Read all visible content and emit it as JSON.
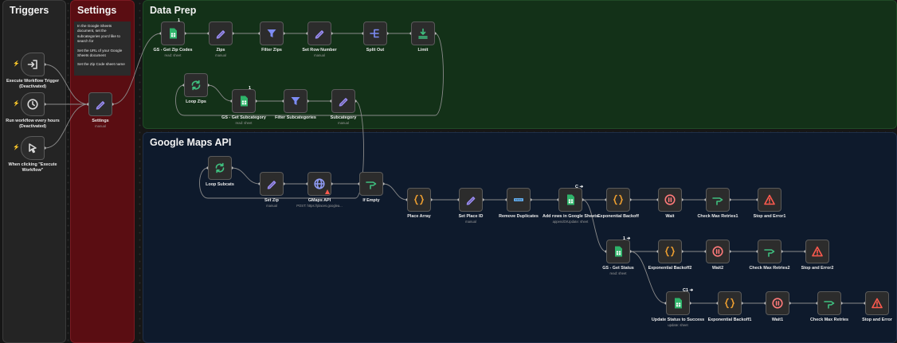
{
  "canvas": {
    "sticky_notes": [
      {
        "id": "triggers",
        "title": "Triggers",
        "lines": [],
        "color": "#242424",
        "border": "#3a3a3a"
      },
      {
        "id": "settings",
        "title": "Settings",
        "lines": [
          "In the Google Sheets document, set the subcategories you'd like to search for",
          "Set the URL of your Google Sheets document",
          "Set the Zip Code sheet name"
        ],
        "color": "#5a0d12",
        "border": "#7a1a22"
      },
      {
        "id": "dataprep",
        "title": "Data Prep",
        "lines": [],
        "color": "#133118",
        "border": "#1f4a26"
      },
      {
        "id": "gmaps",
        "title": "Google Maps API",
        "lines": [],
        "color": "#0e1a2c",
        "border": "#1f2e47"
      }
    ],
    "nodes": [
      {
        "id": "execute-workflow-trigger",
        "label": "Execute Workflow Trigger (Deactivated)",
        "subtitle": "",
        "icon": "arrow-in-icon",
        "icon_color": "#d8d8d8",
        "trigger": true
      },
      {
        "id": "schedule-trigger",
        "label": "Run workflow every hours (Deactivated)",
        "subtitle": "",
        "icon": "clock-icon",
        "icon_color": "#d8d8d8",
        "trigger": true
      },
      {
        "id": "manual-trigger",
        "label": "When clicking \"Execute Workflow\"",
        "subtitle": "",
        "icon": "cursor-icon",
        "icon_color": "#d8d8d8",
        "trigger": true
      },
      {
        "id": "settings",
        "label": "Settings",
        "subtitle": "manual",
        "icon": "pencil-icon",
        "icon_color": "#9b8cf5"
      },
      {
        "id": "gs-get-zip-codes",
        "label": "GS - Get Zip Codes",
        "subtitle": "read: sheet",
        "icon": "sheets-icon",
        "icon_color": "#2eb46a",
        "badge": "1"
      },
      {
        "id": "zips",
        "label": "Zips",
        "subtitle": "manual",
        "icon": "pencil-icon",
        "icon_color": "#9b8cf5"
      },
      {
        "id": "filter-zips",
        "label": "Filter Zips",
        "subtitle": "",
        "icon": "filter-icon",
        "icon_color": "#7d8cf5"
      },
      {
        "id": "set-row-number",
        "label": "Set Row Number",
        "subtitle": "manual",
        "icon": "pencil-icon",
        "icon_color": "#9b8cf5"
      },
      {
        "id": "split-out",
        "label": "Split Out",
        "subtitle": "",
        "icon": "split-icon",
        "icon_color": "#7d8cf5"
      },
      {
        "id": "limit",
        "label": "Limit",
        "subtitle": "",
        "icon": "limit-icon",
        "icon_color": "#3fbf7f"
      },
      {
        "id": "loop-zips",
        "label": "Loop Zips",
        "subtitle": "",
        "icon": "loop-icon",
        "icon_color": "#3fbf7f"
      },
      {
        "id": "gs-get-subcategory",
        "label": "GS - Get Subcategory",
        "subtitle": "read: sheet",
        "icon": "sheets-icon",
        "icon_color": "#2eb46a",
        "badge": "1"
      },
      {
        "id": "filter-subcategories",
        "label": "Filter Subcategories",
        "subtitle": "",
        "icon": "filter-icon",
        "icon_color": "#7d8cf5"
      },
      {
        "id": "subcategory",
        "label": "Subcategory",
        "subtitle": "manual",
        "icon": "pencil-icon",
        "icon_color": "#9b8cf5"
      },
      {
        "id": "loop-subcats",
        "label": "Loop Subcats",
        "subtitle": "",
        "icon": "loop-icon",
        "icon_color": "#3fbf7f"
      },
      {
        "id": "set-zip",
        "label": "Set Zip",
        "subtitle": "manual",
        "icon": "pencil-icon",
        "icon_color": "#9b8cf5"
      },
      {
        "id": "gmaps-api",
        "label": "GMaps API",
        "subtitle": "POST: https://places.googleа...",
        "icon": "globe-icon",
        "icon_color": "#8f9bf5",
        "warning": true
      },
      {
        "id": "if-empty",
        "label": "If Empty",
        "subtitle": "",
        "icon": "if-icon",
        "icon_color": "#3fbf7f"
      },
      {
        "id": "place-array",
        "label": "Place Array",
        "subtitle": "",
        "icon": "braces-icon",
        "icon_color": "#f0a030"
      },
      {
        "id": "set-place-id",
        "label": "Set Place ID",
        "subtitle": "manual",
        "icon": "pencil-icon",
        "icon_color": "#9b8cf5"
      },
      {
        "id": "remove-duplicates",
        "label": "Remove Duplicates",
        "subtitle": "",
        "icon": "dedupe-icon",
        "icon_color": "#5fa8e8"
      },
      {
        "id": "add-rows-sheets",
        "label": "Add rows in Google Sheets",
        "subtitle": "appendOrUpdate: sheet",
        "icon": "sheets-icon",
        "icon_color": "#2eb46a",
        "badge": "C ➔"
      },
      {
        "id": "exponential-backoff",
        "label": "Exponential Backoff",
        "subtitle": "",
        "icon": "braces-icon",
        "icon_color": "#f0a030"
      },
      {
        "id": "wait",
        "label": "Wait",
        "subtitle": "",
        "icon": "pause-icon",
        "icon_color": "#ff7a7a"
      },
      {
        "id": "check-max-retries1",
        "label": "Check Max Retries1",
        "subtitle": "",
        "icon": "if-icon",
        "icon_color": "#3fbf7f"
      },
      {
        "id": "stop-and-error1",
        "label": "Stop and Error1",
        "subtitle": "",
        "icon": "warning-icon",
        "icon_color": "#ff5a4e"
      },
      {
        "id": "gs-get-status",
        "label": "GS - Get Status",
        "subtitle": "read: sheet",
        "icon": "sheets-icon",
        "icon_color": "#2eb46a",
        "badge": "1 ➔"
      },
      {
        "id": "exponential-backoff2",
        "label": "Exponential Backoff2",
        "subtitle": "",
        "icon": "braces-icon",
        "icon_color": "#f0a030"
      },
      {
        "id": "wait2",
        "label": "Wait2",
        "subtitle": "",
        "icon": "pause-icon",
        "icon_color": "#ff7a7a"
      },
      {
        "id": "check-max-retries2",
        "label": "Check Max Retries2",
        "subtitle": "",
        "icon": "if-icon",
        "icon_color": "#3fbf7f"
      },
      {
        "id": "stop-and-error2",
        "label": "Stop and Error2",
        "subtitle": "",
        "icon": "warning-icon",
        "icon_color": "#ff5a4e"
      },
      {
        "id": "update-status-success",
        "label": "Update Status to Success",
        "subtitle": "update: sheet",
        "icon": "sheets-icon",
        "icon_color": "#2eb46a",
        "badge": "C1 ➔"
      },
      {
        "id": "exponential-backoff1",
        "label": "Exponential Backoff1",
        "subtitle": "",
        "icon": "braces-icon",
        "icon_color": "#f0a030"
      },
      {
        "id": "wait1",
        "label": "Wait1",
        "subtitle": "",
        "icon": "pause-icon",
        "icon_color": "#ff7a7a"
      },
      {
        "id": "check-max-retries",
        "label": "Check Max Retries",
        "subtitle": "",
        "icon": "if-icon",
        "icon_color": "#3fbf7f"
      },
      {
        "id": "stop-and-error",
        "label": "Stop and Error",
        "subtitle": "",
        "icon": "warning-icon",
        "icon_color": "#ff5a4e"
      }
    ],
    "connections": [
      [
        "execute-workflow-trigger",
        "settings"
      ],
      [
        "schedule-trigger",
        "settings"
      ],
      [
        "manual-trigger",
        "settings"
      ],
      [
        "settings",
        "gs-get-zip-codes"
      ],
      [
        "gs-get-zip-codes",
        "zips"
      ],
      [
        "zips",
        "filter-zips"
      ],
      [
        "filter-zips",
        "set-row-number"
      ],
      [
        "set-row-number",
        "split-out"
      ],
      [
        "split-out",
        "limit"
      ],
      [
        "limit",
        "loop-zips"
      ],
      [
        "loop-zips",
        "gs-get-subcategory"
      ],
      [
        "gs-get-subcategory",
        "filter-subcategories"
      ],
      [
        "filter-subcategories",
        "subcategory"
      ],
      [
        "subcategory",
        "loop-subcats"
      ],
      [
        "loop-subcats",
        "set-zip"
      ],
      [
        "set-zip",
        "gmaps-api"
      ],
      [
        "gmaps-api",
        "if-empty"
      ],
      [
        "if-empty",
        "place-array"
      ],
      [
        "place-array",
        "set-place-id"
      ],
      [
        "set-place-id",
        "remove-duplicates"
      ],
      [
        "remove-duplicates",
        "add-rows-sheets"
      ],
      [
        "add-rows-sheets",
        "exponential-backoff"
      ],
      [
        "exponential-backoff",
        "wait"
      ],
      [
        "wait",
        "check-max-retries1"
      ],
      [
        "check-max-retries1",
        "stop-and-error1"
      ],
      [
        "add-rows-sheets",
        "gs-get-status"
      ],
      [
        "gs-get-status",
        "exponential-backoff2"
      ],
      [
        "exponential-backoff2",
        "wait2"
      ],
      [
        "wait2",
        "check-max-retries2"
      ],
      [
        "check-max-retries2",
        "stop-and-error2"
      ],
      [
        "gs-get-status",
        "update-status-success"
      ],
      [
        "update-status-success",
        "exponential-backoff1"
      ],
      [
        "exponential-backoff1",
        "wait1"
      ],
      [
        "wait1",
        "check-max-retries"
      ],
      [
        "check-max-retries",
        "stop-and-error"
      ]
    ]
  }
}
